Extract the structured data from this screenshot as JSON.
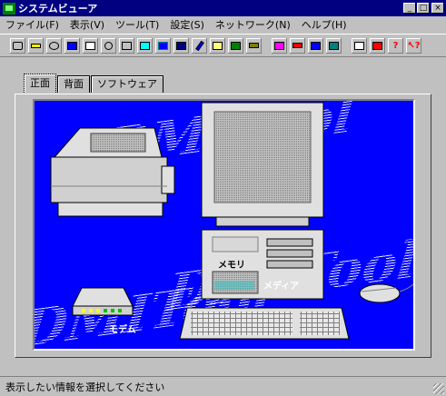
{
  "window": {
    "title": "システムビューア",
    "buttons": [
      "_",
      "□",
      "×"
    ]
  },
  "menu": {
    "items": [
      "ファイル(F)",
      "表示(V)",
      "ツール(T)",
      "設定(S)",
      "ネットワーク(N)",
      "ヘルプ(H)"
    ]
  },
  "toolbar": {
    "icons": [
      "computer-icon",
      "memory-icon",
      "cpu-icon",
      "monitor-icon",
      "printer-icon",
      "disk-icon",
      "storage-icon",
      "printer2-icon",
      "floppy-icon",
      "drive-icon",
      "pen-icon",
      "document-icon",
      "display-icon",
      "keyboard-icon",
      "network-icon",
      "card-icon",
      "chip-icon",
      "board-icon",
      "chart-icon",
      "window-icon",
      "help-icon",
      "context-help-icon"
    ]
  },
  "tabs": [
    "正面",
    "背面",
    "ソフトウェア"
  ],
  "stage": {
    "watermark": "DMITool",
    "memory_label": "メモリ",
    "media_label": "メディア",
    "modem_label": "モデム"
  },
  "status": "表示したい情報を選択してください",
  "colors": {
    "titlebar": "#000080",
    "stage": "#0000ff",
    "chrome": "#c0c0c0"
  }
}
